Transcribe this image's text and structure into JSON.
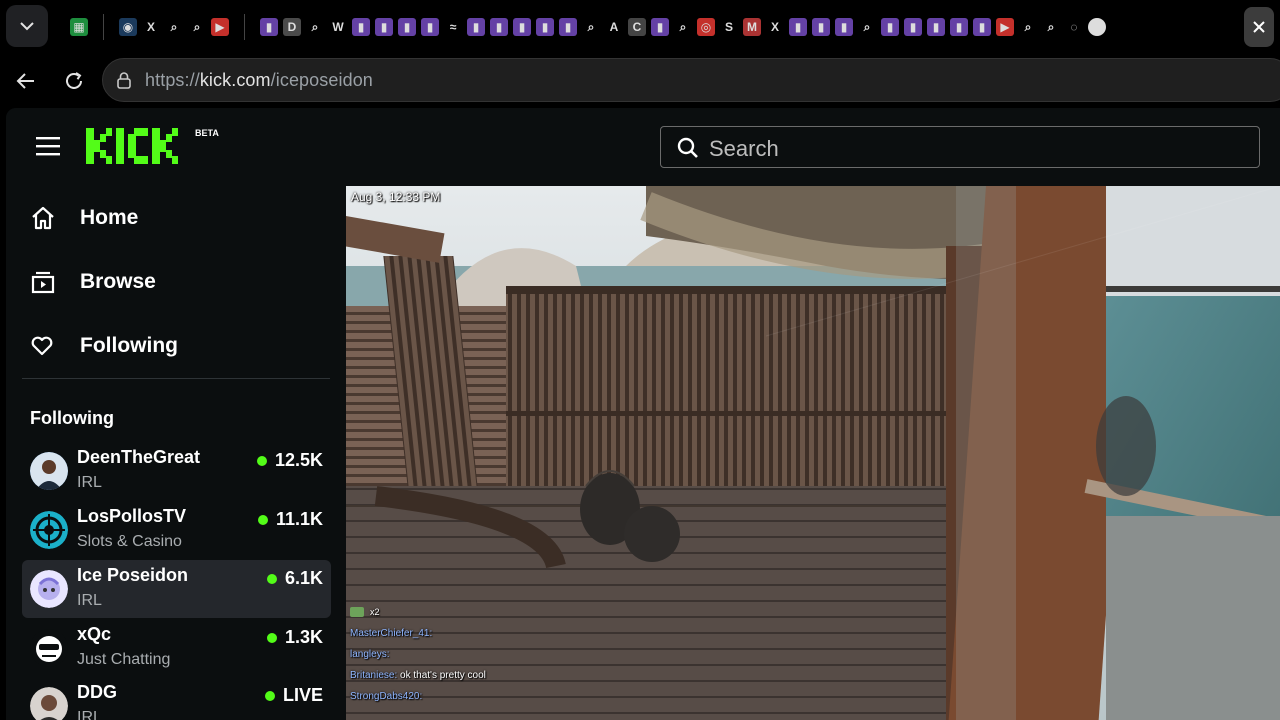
{
  "browser": {
    "url_prefix": "https://",
    "url_domain": "kick.com",
    "url_path": "/iceposeidon",
    "tab_favicons": [
      "sheets-icon",
      "globe-icon",
      "x-icon",
      "search-icon",
      "search-icon",
      "youtube-icon",
      "twitch-icon",
      "d-icon",
      "search-icon",
      "willy-icon",
      "twitch-icon",
      "twitch-icon",
      "twitch-icon",
      "twitch-icon",
      "bird-icon",
      "twitch-icon",
      "twitch-icon",
      "twitch-icon",
      "twitch-icon",
      "twitch-icon",
      "search-icon",
      "a-icon",
      "c-icon",
      "twitch-icon",
      "search-icon",
      "toyota-icon",
      "stake-icon",
      "m-icon",
      "x-icon",
      "twitch-icon",
      "twitch-icon",
      "twitch-icon",
      "search-icon",
      "twitch-icon",
      "twitch-icon",
      "twitch-icon",
      "twitch-icon",
      "twitch-icon",
      "youtube-icon",
      "search-icon",
      "search-icon",
      "loading-icon",
      "circle-icon"
    ]
  },
  "header": {
    "logo_text": "KICK",
    "beta_label": "BETA",
    "search_placeholder": "Search"
  },
  "sidebar": {
    "nav": [
      {
        "label": "Home",
        "icon": "home-icon"
      },
      {
        "label": "Browse",
        "icon": "browse-icon"
      },
      {
        "label": "Following",
        "icon": "heart-icon"
      }
    ],
    "following_title": "Following",
    "channels": [
      {
        "name": "DeenTheGreat",
        "category": "IRL",
        "viewers": "12.5K",
        "avatar_color": "#3a6ea5"
      },
      {
        "name": "LosPollosTV",
        "category": "Slots & Casino",
        "viewers": "11.1K",
        "avatar_color": "#1bb0c9"
      },
      {
        "name": "Ice Poseidon",
        "category": "IRL",
        "viewers": "6.1K",
        "avatar_color": "#c9c6f2"
      },
      {
        "name": "xQc",
        "category": "Just Chatting",
        "viewers": "1.3K",
        "avatar_color": "#1a1a1a"
      },
      {
        "name": "DDG",
        "category": "IRL",
        "viewers": "LIVE",
        "avatar_color": "#6b4a3a"
      }
    ]
  },
  "video": {
    "timestamp": "Aug 3, 12:33 PM",
    "chat_x2": "x2",
    "chat": [
      {
        "user": "MasterChiefer_41:",
        "msg": ""
      },
      {
        "user": "langleys:",
        "msg": ""
      },
      {
        "user": "Britaniese:",
        "msg": "ok that's pretty cool"
      },
      {
        "user": "StrongDabs420:",
        "msg": ""
      }
    ]
  },
  "colors": {
    "accent": "#53fc18",
    "live_dot": "#53fc18",
    "page_bg": "#0b0e0f",
    "active_item": "#24272c"
  }
}
